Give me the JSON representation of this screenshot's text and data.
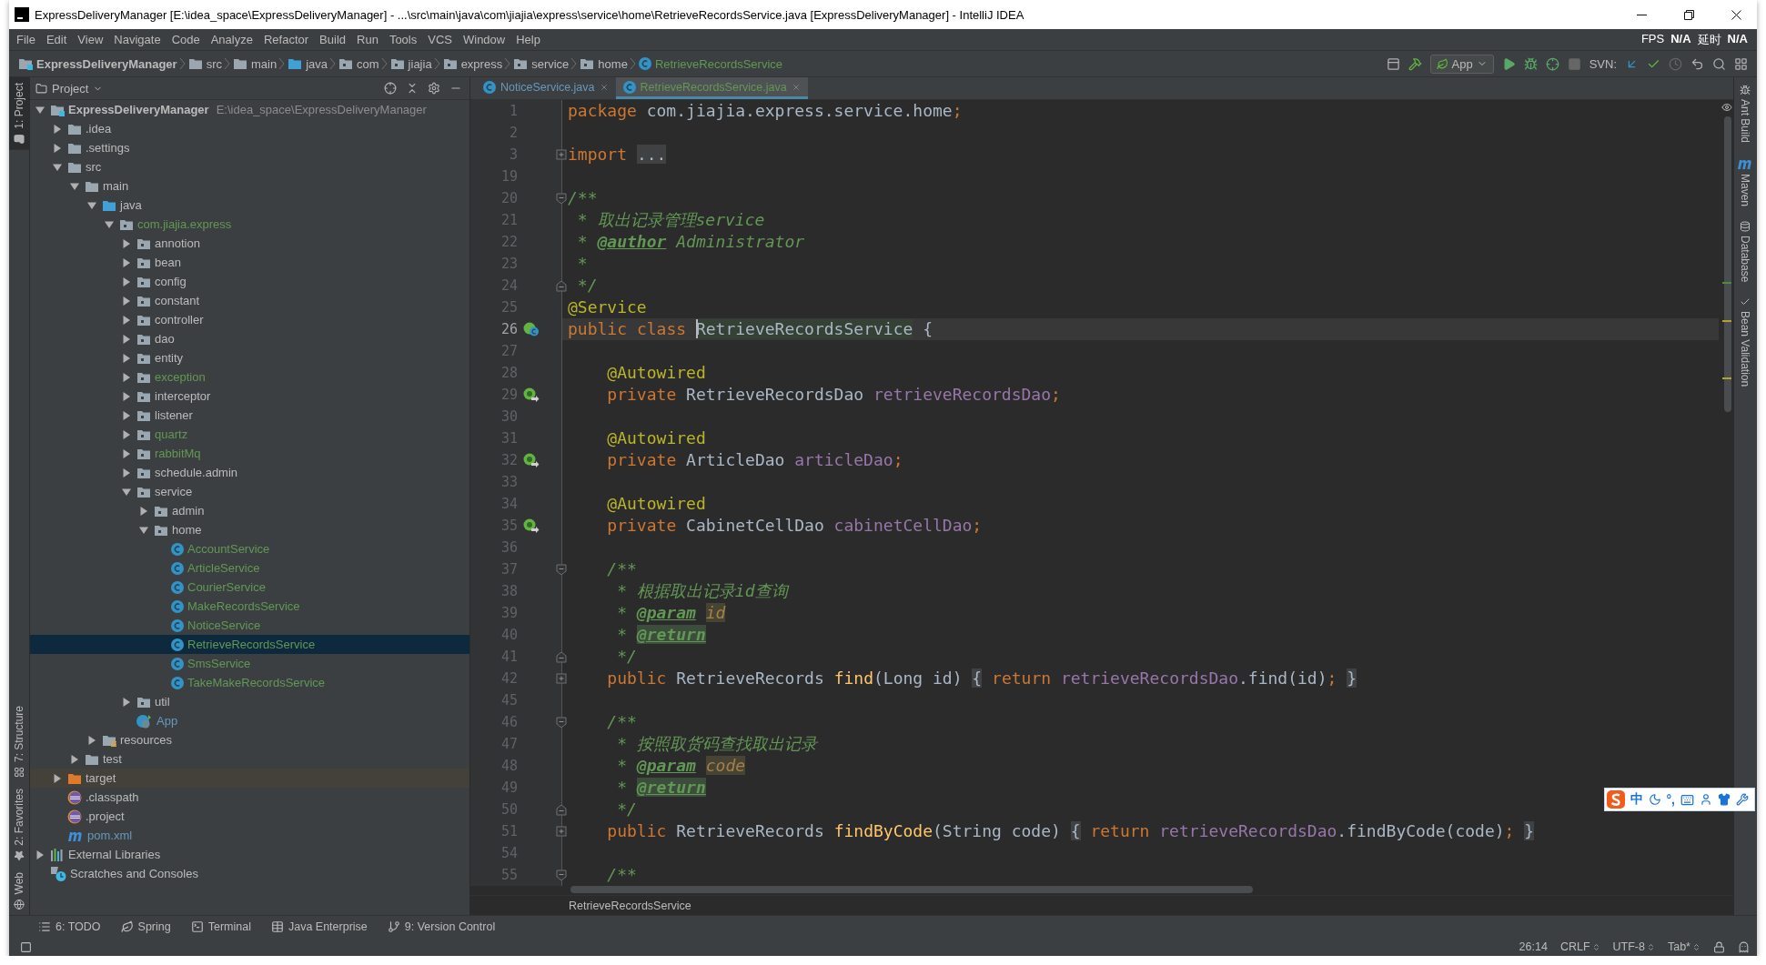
{
  "window": {
    "title": "ExpressDeliveryManager [E:\\idea_space\\ExpressDeliveryManager] - ...\\src\\main\\java\\com\\jiajia\\express\\service\\home\\RetrieveRecordsService.java [ExpressDeliveryManager] - IntelliJ IDEA"
  },
  "menu": [
    "File",
    "Edit",
    "View",
    "Navigate",
    "Code",
    "Analyze",
    "Refactor",
    "Build",
    "Run",
    "Tools",
    "VCS",
    "Window",
    "Help"
  ],
  "fps_overlay": [
    "FPS",
    "N/A",
    "延时",
    "N/A"
  ],
  "nav_bar": {
    "crumbs": [
      {
        "label": "ExpressDeliveryManager",
        "kind": "module"
      },
      {
        "label": "src",
        "kind": "folder"
      },
      {
        "label": "main",
        "kind": "folder"
      },
      {
        "label": "java",
        "kind": "source"
      },
      {
        "label": "com",
        "kind": "package"
      },
      {
        "label": "jiajia",
        "kind": "package"
      },
      {
        "label": "express",
        "kind": "package"
      },
      {
        "label": "service",
        "kind": "package"
      },
      {
        "label": "home",
        "kind": "package"
      },
      {
        "label": "RetrieveRecordsService",
        "kind": "class",
        "color": "#629755"
      }
    ],
    "run_config": "App",
    "vcs_label": "SVN:"
  },
  "left_stripe": [
    {
      "label": "1: Project",
      "kind": "project",
      "selected": true
    },
    {
      "label": "7: Structure",
      "kind": "structure",
      "selected": false
    },
    {
      "label": "2: Favorites",
      "kind": "favorites",
      "selected": false
    },
    {
      "label": "Web",
      "kind": "web",
      "selected": false
    }
  ],
  "project_panel": {
    "title": "Project",
    "tree": [
      {
        "label": "ExpressDeliveryManager",
        "path": "E:\\idea_space\\ExpressDeliveryManager",
        "kind": "module",
        "expanded": true,
        "selected": false,
        "children": [
          {
            "label": ".idea",
            "kind": "folder",
            "expanded": false,
            "selected": false
          },
          {
            "label": ".settings",
            "kind": "folder",
            "expanded": false,
            "selected": false
          },
          {
            "label": "src",
            "kind": "folder",
            "expanded": true,
            "selected": false,
            "children": [
              {
                "label": "main",
                "kind": "folder",
                "expanded": true,
                "selected": false,
                "children": [
                  {
                    "label": "java",
                    "kind": "source",
                    "expanded": true,
                    "selected": false,
                    "children": [
                      {
                        "label": "com.jiajia.express",
                        "kind": "package",
                        "color": "#629755",
                        "expanded": true,
                        "selected": false,
                        "children": [
                          {
                            "label": "annotion",
                            "kind": "package",
                            "expanded": false,
                            "selected": false
                          },
                          {
                            "label": "bean",
                            "kind": "package",
                            "expanded": false,
                            "selected": false
                          },
                          {
                            "label": "config",
                            "kind": "package",
                            "expanded": false,
                            "selected": false
                          },
                          {
                            "label": "constant",
                            "kind": "package",
                            "expanded": false,
                            "selected": false
                          },
                          {
                            "label": "controller",
                            "kind": "package",
                            "expanded": false,
                            "selected": false
                          },
                          {
                            "label": "dao",
                            "kind": "package",
                            "expanded": false,
                            "selected": false
                          },
                          {
                            "label": "entity",
                            "kind": "package",
                            "expanded": false,
                            "selected": false
                          },
                          {
                            "label": "exception",
                            "kind": "package",
                            "color": "#629755",
                            "expanded": false,
                            "selected": false
                          },
                          {
                            "label": "interceptor",
                            "kind": "package",
                            "expanded": false,
                            "selected": false
                          },
                          {
                            "label": "listener",
                            "kind": "package",
                            "expanded": false,
                            "selected": false
                          },
                          {
                            "label": "quartz",
                            "kind": "package",
                            "color": "#629755",
                            "expanded": false,
                            "selected": false
                          },
                          {
                            "label": "rabbitMq",
                            "kind": "package",
                            "color": "#629755",
                            "expanded": false,
                            "selected": false
                          },
                          {
                            "label": "schedule.admin",
                            "kind": "package",
                            "expanded": false,
                            "selected": false
                          },
                          {
                            "label": "service",
                            "kind": "package",
                            "expanded": true,
                            "selected": false,
                            "children": [
                              {
                                "label": "admin",
                                "kind": "package",
                                "expanded": false,
                                "selected": false
                              },
                              {
                                "label": "home",
                                "kind": "package",
                                "expanded": true,
                                "selected": false,
                                "children": [
                                  {
                                    "label": "AccountService",
                                    "kind": "class",
                                    "color": "#629755",
                                    "selected": false
                                  },
                                  {
                                    "label": "ArticleService",
                                    "kind": "class",
                                    "color": "#629755",
                                    "selected": false
                                  },
                                  {
                                    "label": "CourierService",
                                    "kind": "class",
                                    "color": "#629755",
                                    "selected": false
                                  },
                                  {
                                    "label": "MakeRecordsService",
                                    "kind": "class",
                                    "color": "#629755",
                                    "selected": false
                                  },
                                  {
                                    "label": "NoticeService",
                                    "kind": "class",
                                    "color": "#629755",
                                    "selected": false
                                  },
                                  {
                                    "label": "RetrieveRecordsService",
                                    "kind": "class",
                                    "color": "#629755",
                                    "selected": true
                                  },
                                  {
                                    "label": "SmsService",
                                    "kind": "class",
                                    "color": "#629755",
                                    "selected": false
                                  },
                                  {
                                    "label": "TakeMakeRecordsService",
                                    "kind": "class",
                                    "color": "#629755",
                                    "selected": false
                                  }
                                ]
                              }
                            ]
                          },
                          {
                            "label": "util",
                            "kind": "package",
                            "expanded": false,
                            "selected": false
                          },
                          {
                            "label": "App",
                            "kind": "spring",
                            "color": "#6897bb",
                            "selected": false
                          }
                        ]
                      }
                    ]
                  },
                  {
                    "label": "resources",
                    "kind": "resources",
                    "expanded": false,
                    "selected": false
                  }
                ]
              },
              {
                "label": "test",
                "kind": "folder",
                "expanded": false,
                "selected": false
              }
            ]
          },
          {
            "label": "target",
            "kind": "excluded",
            "expanded": false,
            "selected": false
          },
          {
            "label": ".classpath",
            "kind": "eclipse",
            "selected": false
          },
          {
            "label": ".project",
            "kind": "eclipse",
            "selected": false
          },
          {
            "label": "pom.xml",
            "kind": "maven",
            "color": "#6897bb",
            "selected": false
          }
        ]
      },
      {
        "label": "External Libraries",
        "kind": "libraries",
        "expanded": false,
        "selected": false
      },
      {
        "label": "Scratches and Consoles",
        "kind": "scratches",
        "selected": false
      }
    ]
  },
  "editor_tabs": [
    {
      "label": "NoticeService.java",
      "color": "#6897bb",
      "selected": false
    },
    {
      "label": "RetrieveRecordsService.java",
      "color": "#629755",
      "selected": true
    }
  ],
  "code": [
    {
      "n": "1",
      "current": false,
      "text": "package com.jiajia.express.service.home;"
    },
    {
      "n": "2",
      "current": false
    },
    {
      "n": "3",
      "current": false,
      "fold": {
        "kind": "collapsed"
      },
      "text": "import ..."
    },
    {
      "n": "19",
      "current": false
    },
    {
      "n": "20",
      "current": false,
      "fold": {
        "kind": "open"
      },
      "text": "/**"
    },
    {
      "n": "21",
      "current": false,
      "text": " * 取出记录管理service"
    },
    {
      "n": "22",
      "current": false,
      "text": " * @author Administrator"
    },
    {
      "n": "23",
      "current": false,
      "text": " *"
    },
    {
      "n": "24",
      "current": false,
      "fold": {
        "kind": "end"
      },
      "text": " */"
    },
    {
      "n": "25",
      "current": false,
      "text": "@Service"
    },
    {
      "n": "26",
      "current": true,
      "gutter": {
        "kind": "class"
      },
      "text": "public class RetrieveRecordsService {"
    },
    {
      "n": "27",
      "current": false
    },
    {
      "n": "28",
      "current": false,
      "text": "    @Autowired"
    },
    {
      "n": "29",
      "current": false,
      "gutter": {
        "kind": "bean"
      },
      "text": "    private RetrieveRecordsDao retrieveRecordsDao;"
    },
    {
      "n": "30",
      "current": false
    },
    {
      "n": "31",
      "current": false,
      "text": "    @Autowired"
    },
    {
      "n": "32",
      "current": false,
      "gutter": {
        "kind": "bean"
      },
      "text": "    private ArticleDao articleDao;"
    },
    {
      "n": "33",
      "current": false
    },
    {
      "n": "34",
      "current": false,
      "text": "    @Autowired"
    },
    {
      "n": "35",
      "current": false,
      "gutter": {
        "kind": "bean"
      },
      "text": "    private CabinetCellDao cabinetCellDao;"
    },
    {
      "n": "36",
      "current": false
    },
    {
      "n": "37",
      "current": false,
      "fold": {
        "kind": "open"
      },
      "text": "    /**"
    },
    {
      "n": "38",
      "current": false,
      "text": "     * 根据取出记录id查询"
    },
    {
      "n": "39",
      "current": false,
      "text": "     * @param id"
    },
    {
      "n": "40",
      "current": false,
      "text": "     * @return"
    },
    {
      "n": "41",
      "current": false,
      "fold": {
        "kind": "end"
      },
      "text": "     */"
    },
    {
      "n": "42",
      "current": false,
      "fold": {
        "kind": "collapsed"
      },
      "text": "    public RetrieveRecords find(Long id) { return retrieveRecordsDao.find(id); }"
    },
    {
      "n": "45",
      "current": false
    },
    {
      "n": "46",
      "current": false,
      "fold": {
        "kind": "open"
      },
      "text": "    /**"
    },
    {
      "n": "47",
      "current": false,
      "text": "     * 按照取货码查找取出记录"
    },
    {
      "n": "48",
      "current": false,
      "text": "     * @param code"
    },
    {
      "n": "49",
      "current": false,
      "text": "     * @return"
    },
    {
      "n": "50",
      "current": false,
      "fold": {
        "kind": "end"
      },
      "text": "     */"
    },
    {
      "n": "51",
      "current": false,
      "fold": {
        "kind": "collapsed"
      },
      "text": "    public RetrieveRecords findByCode(String code) { return retrieveRecordsDao.findByCode(code); }"
    },
    {
      "n": "54",
      "current": false
    },
    {
      "n": "55",
      "current": false,
      "fold": {
        "kind": "open"
      },
      "text": "    /**"
    }
  ],
  "editor_breadcrumb": "RetrieveRecordsService",
  "right_stripe": [
    {
      "label": "Ant Build",
      "kind": "ant"
    },
    {
      "label": "Maven",
      "kind": "maven"
    },
    {
      "label": "Database",
      "kind": "database"
    },
    {
      "label": "Bean Validation",
      "kind": "bean"
    }
  ],
  "bottom_tools": [
    {
      "label": "6: TODO",
      "kind": "todo"
    },
    {
      "label": "Spring",
      "kind": "spring"
    },
    {
      "label": "Terminal",
      "kind": "terminal"
    },
    {
      "label": "Java Enterprise",
      "kind": "javaee"
    },
    {
      "label": "9: Version Control",
      "kind": "vcs"
    }
  ],
  "status_bar": {
    "position": "26:14",
    "line_separator": "CRLF",
    "encoding": "UTF-8",
    "indent": "Tab*"
  },
  "ime_bar": {
    "mode": "中",
    "punctuation": "°,"
  }
}
